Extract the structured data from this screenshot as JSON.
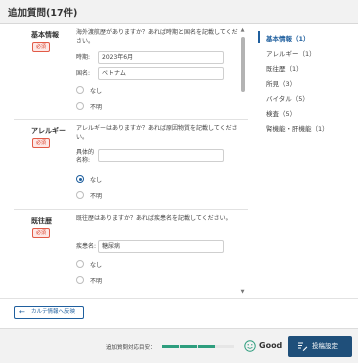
{
  "header": {
    "title": "追加質問(17件)"
  },
  "sections": [
    {
      "title": "基本情報",
      "badge": "必須",
      "question": "海外渡航歴がありますか？あれば時期と国名を記載してください。",
      "fields": [
        {
          "label": "時期:",
          "value": "2023年6月"
        },
        {
          "label": "国名:",
          "value": "ベトナム"
        }
      ],
      "options": [
        {
          "label": "なし",
          "checked": false
        },
        {
          "label": "不明",
          "checked": false
        }
      ]
    },
    {
      "title": "アレルギー",
      "badge": "必須",
      "question": "アレルギーはありますか？あれば原因物質を記載してください。",
      "fields": [
        {
          "label": "具体的\n名称:",
          "value": ""
        }
      ],
      "options": [
        {
          "label": "なし",
          "checked": true
        },
        {
          "label": "不明",
          "checked": false
        }
      ]
    },
    {
      "title": "既往歴",
      "badge": "必須",
      "question": "既往歴はありますか？あれば疾患名を記載してください。",
      "fields": [
        {
          "label": "疾患名:",
          "value": "糖尿病"
        }
      ],
      "options": [
        {
          "label": "なし",
          "checked": false
        },
        {
          "label": "不明",
          "checked": false
        }
      ]
    }
  ],
  "toc": [
    {
      "label": "基本情報（1）",
      "active": true
    },
    {
      "label": "アレルギー（1）",
      "active": false
    },
    {
      "label": "既往歴（1）",
      "active": false
    },
    {
      "label": "所見（3）",
      "active": false
    },
    {
      "label": "バイタル（5）",
      "active": false
    },
    {
      "label": "検査（5）",
      "active": false
    },
    {
      "label": "腎機能・肝機能（1）",
      "active": false
    }
  ],
  "actions": {
    "karte_label": "カルテ情報へ反映",
    "arrow": "←"
  },
  "footer": {
    "label": "追加質問対応目安：",
    "progress_segments_filled": 3,
    "progress_segments_total": 4,
    "status": "Good",
    "submit_label": "投稿設定"
  },
  "colors": {
    "accent": "#1f5f9e",
    "badge_red": "#d9412b",
    "progress": "#2e9e7e",
    "submit_bg": "#1f4f7a"
  },
  "icons": {
    "scroll_up": "▲",
    "scroll_down": "▼",
    "smile": "smile-icon",
    "submit": "edit-settings-icon"
  }
}
